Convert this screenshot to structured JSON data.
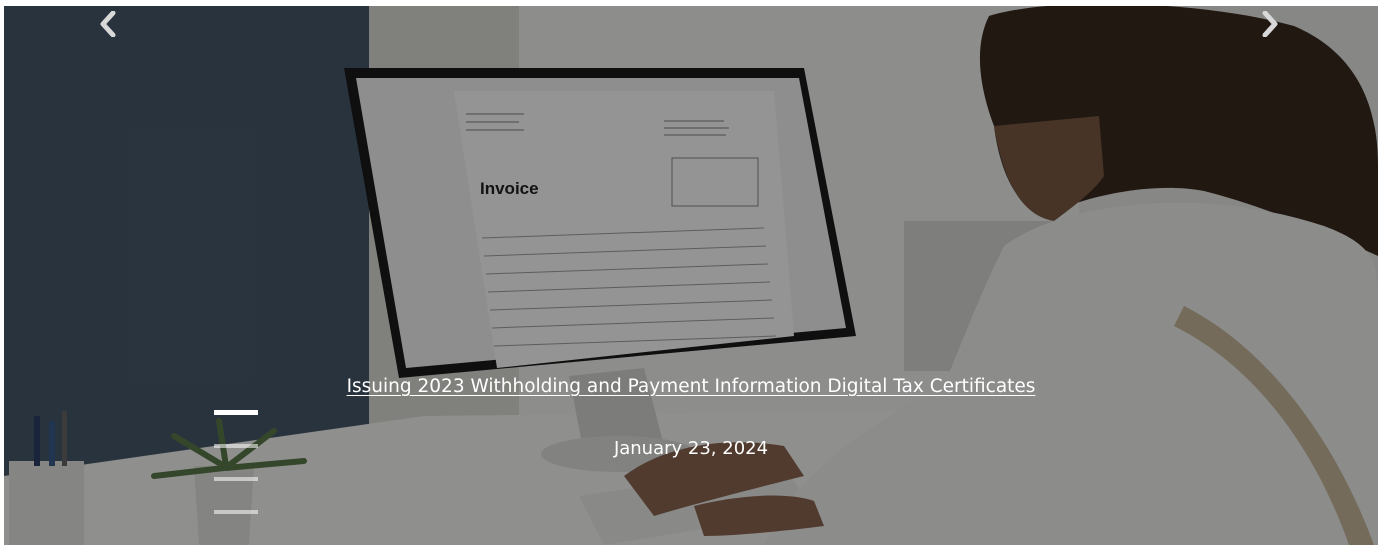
{
  "slide": {
    "title": "Issuing 2023 Withholding and Payment Information Digital Tax Certificates",
    "date": "January 23, 2024",
    "image": {
      "description_icon": "invoice-monitor-photo",
      "invoice_heading": "Invoice"
    }
  },
  "controls": {
    "prev_icon": "chevron-left-icon",
    "next_icon": "chevron-right-icon"
  },
  "indicators": [
    {
      "active": true
    },
    {
      "active": false
    },
    {
      "active": false
    },
    {
      "active": false
    }
  ],
  "colors": {
    "overlay": "#000000",
    "text": "#ffffff",
    "wall_dark": "#445566",
    "wall_light": "#e8e8e6"
  }
}
